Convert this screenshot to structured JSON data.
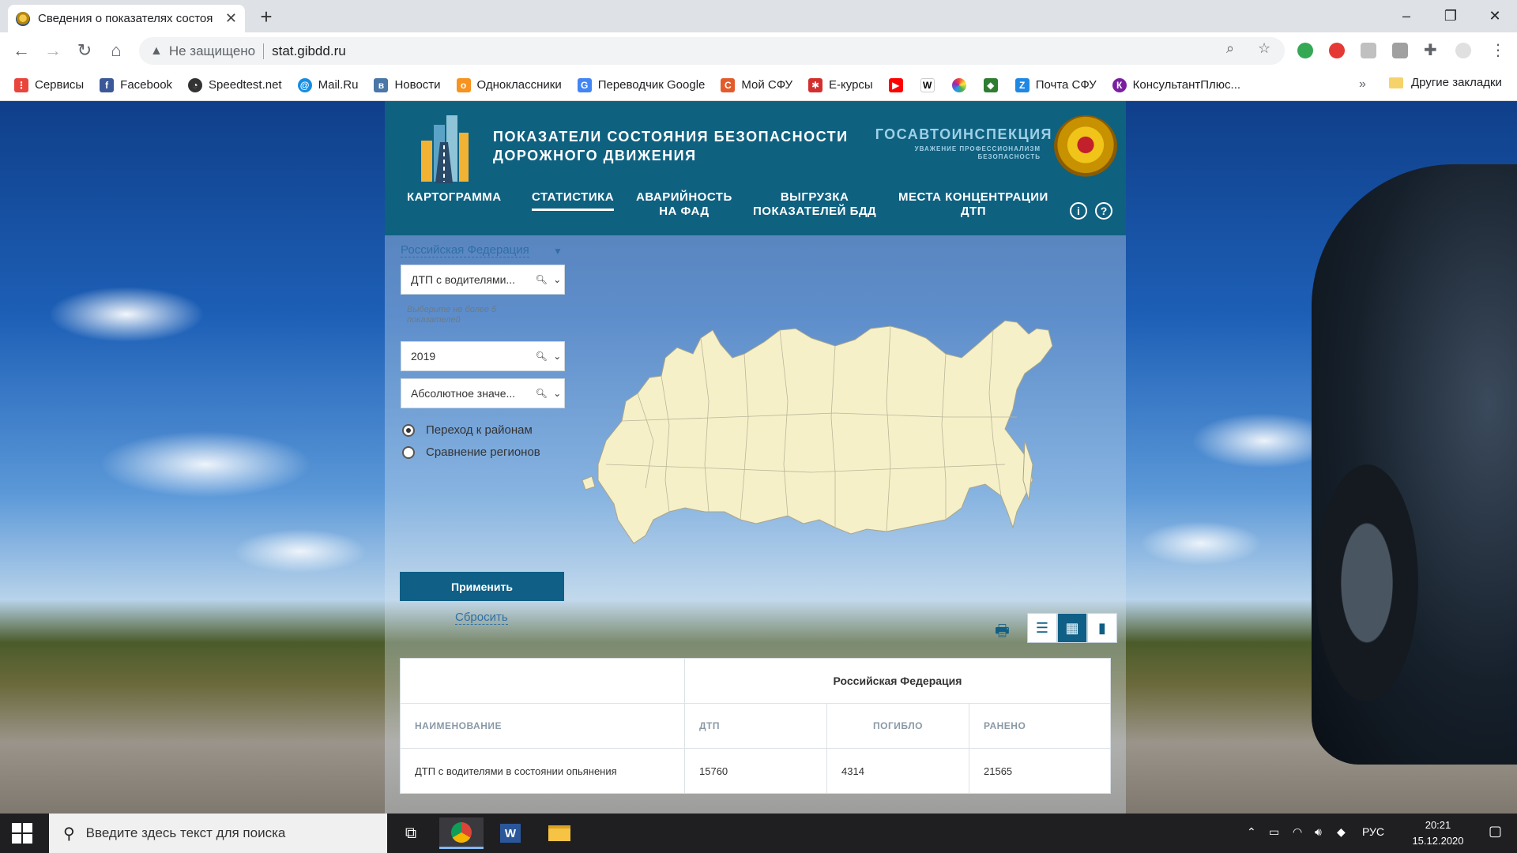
{
  "browser": {
    "tab_title": "Сведения о показателях состоя",
    "new_tab": "+",
    "window_controls": {
      "minimize": "–",
      "restore": "❐",
      "close": "✕"
    },
    "security_warning": "Не защищено",
    "url": "stat.gibdd.ru",
    "bookmarks": [
      {
        "label": "Сервисы",
        "icon": "apps-grid-icon",
        "color": "#e8453c"
      },
      {
        "label": "Facebook",
        "icon": "facebook-icon",
        "color": "#3b5998"
      },
      {
        "label": "Speedtest.net",
        "icon": "speedometer-icon",
        "color": "#333333"
      },
      {
        "label": "Mail.Ru",
        "icon": "mailru-icon",
        "color": "#168de2"
      },
      {
        "label": "Новости",
        "icon": "vk-icon",
        "color": "#4a76a8"
      },
      {
        "label": "Одноклассники",
        "icon": "odnoklassniki-icon",
        "color": "#f7931e"
      },
      {
        "label": "Переводчик Google",
        "icon": "google-translate-icon",
        "color": "#4285f4"
      },
      {
        "label": "Мой СФУ",
        "icon": "sfu-icon",
        "color": "#e25c2b"
      },
      {
        "label": "Е-курсы",
        "icon": "ecourses-icon",
        "color": "#d32f2f"
      },
      {
        "label": "",
        "icon": "youtube-icon",
        "color": "#ff0000"
      },
      {
        "label": "",
        "icon": "wikipedia-icon",
        "color": "#000000"
      },
      {
        "label": "",
        "icon": "color-wheel-icon",
        "color": "#9c27b0"
      },
      {
        "label": "",
        "icon": "game-icon",
        "color": "#2e7d32"
      },
      {
        "label": "Почта СФУ",
        "icon": "zimbra-mail-icon",
        "color": "#1e88e5"
      },
      {
        "label": "КонсультантПлюс...",
        "icon": "consultant-icon",
        "color": "#7b1fa2"
      }
    ],
    "bookmarks_more": "»",
    "other_bookmarks": "Другие закладки"
  },
  "site": {
    "title_line1": "ПОКАЗАТЕЛИ СОСТОЯНИЯ БЕЗОПАСНОСТИ",
    "title_line2": "ДОРОЖНОГО ДВИЖЕНИЯ",
    "gai_title": "ГОСАВТОИНСПЕКЦИЯ",
    "gai_subtitle_1": "УВАЖЕНИЕ ПРОФЕССИОНАЛИЗМ",
    "gai_subtitle_2": "БЕЗОПАСНОСТЬ",
    "nav": {
      "kartogramma": "КАРТОГРАММА",
      "statistika": "СТАТИСТИКА",
      "avariynost_1": "АВАРИЙНОСТЬ",
      "avariynost_2": "НА ФАД",
      "vygruzka_1": "ВЫГРУЗКА",
      "vygruzka_2": "ПОКАЗАТЕЛЕЙ БДД",
      "mesta_1": "МЕСТА КОНЦЕНТРАЦИИ",
      "mesta_2": "ДТП",
      "info": "i",
      "help": "?"
    },
    "filters": {
      "region": "Российская Федерация",
      "indicator": "ДТП с водителями...",
      "hint": "Выберите не более 5 показателей",
      "year": "2019",
      "value_type": "Абсолютное значе...",
      "radio_districts": "Переход к районам",
      "radio_compare": "Сравнение регионов",
      "apply": "Применить",
      "reset": "Сбросить"
    },
    "table": {
      "region_header": "Российская Федерация",
      "columns": [
        "НАИМЕНОВАНИЕ",
        "ДТП",
        "ПОГИБЛО",
        "РАНЕНО"
      ],
      "rows": [
        {
          "name": "ДТП с водителями в состоянии опьянения",
          "dtp": "15760",
          "killed": "4314",
          "injured": "21565"
        }
      ]
    }
  },
  "taskbar": {
    "search_placeholder": "Введите здесь текст для поиска",
    "lang": "РУС",
    "time": "20:21",
    "date": "15.12.2020"
  }
}
